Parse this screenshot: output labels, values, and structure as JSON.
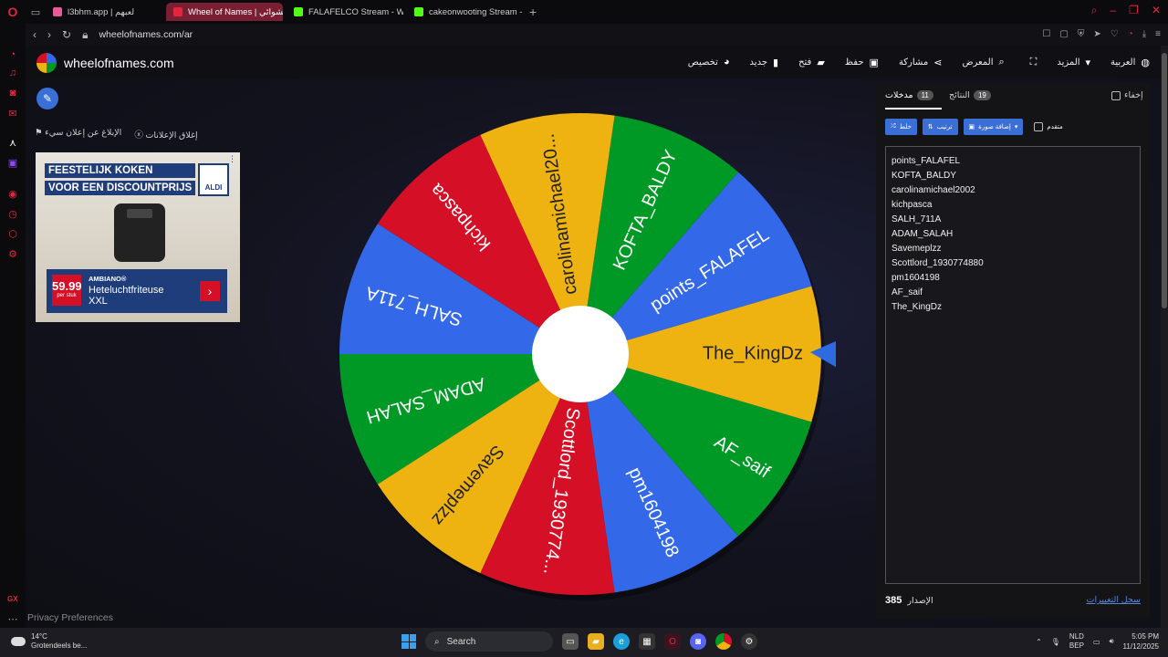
{
  "browser": {
    "tabs": [
      {
        "label": "l3bhm.app | لعبهم",
        "color": "#e85a9a"
      },
      {
        "label": "Wheel of Names | عشوائي",
        "color": "#e3263d"
      },
      {
        "label": "FALAFELCO Stream - Wa",
        "color": "#53fc18"
      },
      {
        "label": "cakeonwooting Stream - V",
        "color": "#53fc18"
      }
    ],
    "new_tab": "+",
    "url": "wheelofnames.com/ar"
  },
  "site": {
    "logo_text": "wheelofnames.com",
    "menu": [
      {
        "label": "العربية",
        "icon": "globe-icon",
        "glyph": "◍"
      },
      {
        "label": "المزيد",
        "icon": "chevron-down-icon",
        "glyph": "▾"
      },
      {
        "label": "",
        "icon": "fullscreen-icon",
        "glyph": "⛶"
      },
      {
        "label": "المعرض",
        "icon": "search-icon",
        "glyph": "⌕"
      },
      {
        "label": "مشاركة",
        "icon": "share-icon",
        "glyph": "⋖"
      },
      {
        "label": "حفظ",
        "icon": "save-icon",
        "glyph": "▣"
      },
      {
        "label": "فتح",
        "icon": "folder-icon",
        "glyph": "▰"
      },
      {
        "label": "جديد",
        "icon": "new-file-icon",
        "glyph": "▮"
      },
      {
        "label": "تخصيص",
        "icon": "palette-icon",
        "glyph": "◕"
      }
    ],
    "ad_links": {
      "report": "الإبلاغ عن إعلان سيء",
      "close": "إغلاق الإعلانات"
    },
    "ad": {
      "headline1": "FEESTELIJK KOKEN",
      "headline2": "VOOR EEN DISCOUNTPRIJS",
      "store": "ALDI",
      "price": "59.99",
      "price_note": "per stuk",
      "brand": "AMBIANO®",
      "product_line1": "Heteluchtfriteuse",
      "product_line2": "XXL"
    },
    "privacy": "Privacy Preferences"
  },
  "wheel": {
    "colors": [
      "#3369e8",
      "#009925",
      "#eeb211",
      "#d50f25"
    ],
    "pointer_color": "#2f6be0",
    "segments": [
      "points_FALAFEL",
      "KOFTA_BALDY",
      "carolinamichael20...",
      "kichpasca",
      "SALH_711A",
      "ADAM_SALAH",
      "Savemeplzz",
      "Scottlord_193077​4...",
      "pm1604198",
      "AF_saif",
      "The_KingDz"
    ]
  },
  "panel": {
    "hide_label": "إخفاء",
    "tab_entries": {
      "label": "مدخلات",
      "count": "11"
    },
    "tab_results": {
      "label": "النتائج",
      "count": "19"
    },
    "buttons": {
      "shuffle": "خلط",
      "sort": "ترتيب",
      "add_image": "إضافة صورة",
      "advanced": "متقدم"
    },
    "entries": [
      "points_FALAFEL",
      "KOFTA_BALDY",
      "carolinamichael2002",
      "kichpasca",
      "SALH_711A",
      "ADAM_SALAH",
      "Savemeplzz",
      "Scottlord_1930774880",
      "pm1604198",
      "AF_saif",
      "The_KingDz"
    ],
    "version_label": "الإصدار",
    "version": "385",
    "changelog": "سجل التغييرات"
  },
  "taskbar": {
    "temp": "14°C",
    "weather": "Grotendeels be...",
    "search": "Search",
    "lang1": "NLD",
    "lang2": "BEP",
    "time": "5:05 PM",
    "date": "11/12/2025"
  }
}
